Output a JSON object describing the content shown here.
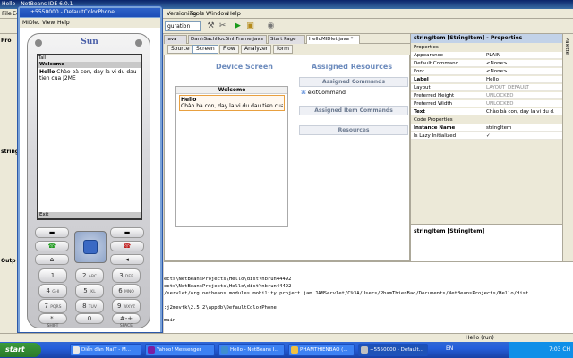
{
  "ide": {
    "title": "Hello - NetBeans IDE 6.0.1",
    "menu": [
      "File",
      "Edit",
      "View",
      "Navigate",
      "Source",
      "Refactor",
      "Build",
      "Run",
      "Versioning",
      "Tools",
      "Window",
      "Help"
    ],
    "config_combo": "guration",
    "editor_tabs": [
      "java",
      "DanhSachHocSinhFrame.java",
      "Start Page",
      "HelloMIDlet.java *"
    ],
    "sub_tabs": [
      "Source",
      "Screen",
      "Flow",
      "Analyzer"
    ],
    "form_chip": "form",
    "left_strip": [
      "Pro",
      "string",
      "Outp"
    ],
    "palette_label": "Palette"
  },
  "design": {
    "device_screen_title": "Device Screen",
    "screen_form_title": "Welcome",
    "item_label": "Hello",
    "item_text": "Chào bà con, day la vi du dau tien cua J2...",
    "assigned_title": "Assigned Resources",
    "assigned_commands": "Assigned Commands",
    "command": "exitCommand",
    "assigned_item_commands": "Assigned Item Commands",
    "resources": "Resources"
  },
  "properties": {
    "title": "stringItem [StringItem] - Properties",
    "group_properties": "Properties",
    "rows": [
      {
        "k": "Appearance",
        "v": "PLAIN"
      },
      {
        "k": "Default Command",
        "v": "<None>"
      },
      {
        "k": "Font",
        "v": "<None>"
      },
      {
        "k": "Label",
        "v": "Hello"
      },
      {
        "k": "Layout",
        "v": "LAYOUT_DEFAULT"
      },
      {
        "k": "Preferred Height",
        "v": "UNLOCKED"
      },
      {
        "k": "Preferred Width",
        "v": "UNLOCKED"
      },
      {
        "k": "Text",
        "v": "Chào bà con, day la vi du d..."
      }
    ],
    "group_code": "Code Properties",
    "code_rows": [
      {
        "k": "Instance Name",
        "v": "stringItem"
      },
      {
        "k": "Is Lazy Initialized",
        "v": "✓"
      }
    ],
    "description": "stringItem [StringItem]"
  },
  "output": {
    "lines": [
      "ects\\NetBeansProjects\\Hello\\dist\\nbrun44492",
      "ects\\NetBeansProjects\\Hello\\dist\\nbrun44492",
      "/servlet/org.netbeans.modules.mobility.project.jam.JAMServlet/C%3A/Users/PhamThienBao/Documents/NetBeansProjects/Hello/dist",
      "",
      ":j2mevtk\\2.5.2\\appdb\\DefaultColorPhone",
      "",
      "main"
    ]
  },
  "status": {
    "text": "Hello (run)"
  },
  "emulator": {
    "title": "+5550000 - DefaultColorPhone",
    "menu": [
      "MIDlet",
      "View",
      "Help"
    ],
    "logo": "Sun",
    "lcd_status": "Tall",
    "lcd_title": "Welcome",
    "lcd_label": "Hello",
    "lcd_text": "Chào bà con, day la vi du dau tien cua J2ME",
    "soft_left": "Exit",
    "keys": [
      {
        "n": "1",
        "s": ""
      },
      {
        "n": "2",
        "s": "ABC"
      },
      {
        "n": "3",
        "s": "DEF"
      },
      {
        "n": "4",
        "s": "GHI"
      },
      {
        "n": "5",
        "s": "JKL"
      },
      {
        "n": "6",
        "s": "MNO"
      },
      {
        "n": "7",
        "s": "PQRS"
      },
      {
        "n": "8",
        "s": "TUV"
      },
      {
        "n": "9",
        "s": "WXYZ"
      },
      {
        "n": "*.",
        "s": ""
      },
      {
        "n": "0",
        "s": ""
      },
      {
        "n": "#-+",
        "s": ""
      }
    ],
    "shift_label": "SHIFT",
    "space_label": "SPACE"
  },
  "taskbar": {
    "start": "start",
    "tasks": [
      "Diễn đàn MaiT - M...",
      "Yahoo! Messenger",
      "Hello - NetBeans I...",
      "PHAMTHIENBAO (...",
      "+5550000 - Default..."
    ],
    "lang": "EN",
    "time": "7:03 CH"
  },
  "colors": {
    "accent": "#6c8bbd",
    "taskbar": "#245edb",
    "highlight": "#e8a040"
  }
}
